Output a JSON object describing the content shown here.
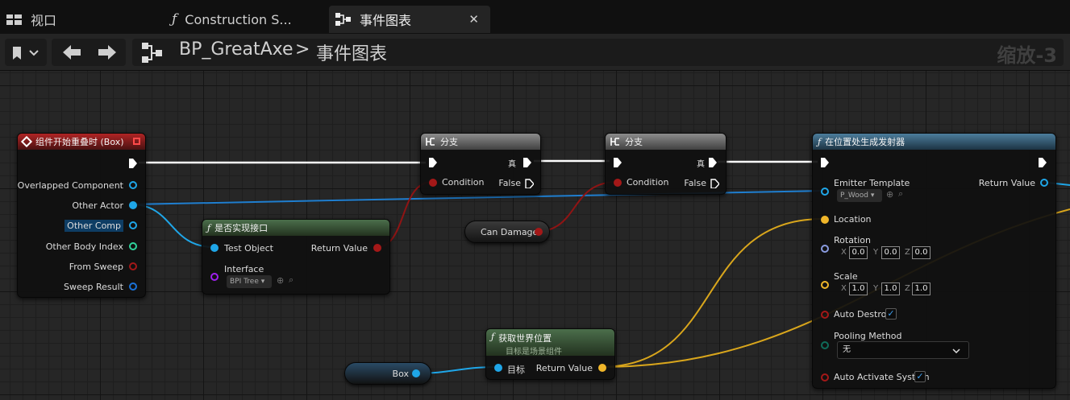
{
  "tabs": [
    {
      "label": "视口",
      "icon": "viewport-grid-icon"
    },
    {
      "label": "Construction S...",
      "icon": "function-icon"
    },
    {
      "label": "事件图表",
      "icon": "graph-icon",
      "active": true
    }
  ],
  "toolbar": {
    "breadcrumb_root": "BP_GreatAxe",
    "breadcrumb_separator": ">",
    "breadcrumb_current": "事件图表",
    "zoom": "缩放-3"
  },
  "nodes": {
    "overlap_event": {
      "title": "组件开始重叠时 (Box)",
      "pins": [
        "Overlapped Component",
        "Other Actor",
        "Other Comp",
        "Other Body Index",
        "From Sweep",
        "Sweep Result"
      ]
    },
    "implements_interface": {
      "title": "是否实现接口",
      "test_object": "Test Object",
      "interface": "Interface",
      "interface_value": "BPI Tree",
      "return_value": "Return Value"
    },
    "branch1": {
      "title": "分支",
      "condition": "Condition",
      "true_label": "真",
      "false_label": "False"
    },
    "branch2": {
      "title": "分支",
      "condition": "Condition",
      "true_label": "真",
      "false_label": "False"
    },
    "can_damage": {
      "label": "Can Damage"
    },
    "box_var": {
      "label": "Box"
    },
    "get_world_location": {
      "title": "获取世界位置",
      "subtitle": "目标是场景组件",
      "target": "目标",
      "return_value": "Return Value"
    },
    "spawn_emitter": {
      "title": "在位置处生成发射器",
      "emitter_template": "Emitter Template",
      "emitter_value": "P_Wood",
      "return_value": "Return Value",
      "location": "Location",
      "rotation": "Rotation",
      "rotation_values": [
        "0.0",
        "0.0",
        "0.0"
      ],
      "scale": "Scale",
      "scale_values": [
        "1.0",
        "1.0",
        "1.0"
      ],
      "axes": [
        "X",
        "Y",
        "Z"
      ],
      "auto_destroy": "Auto Destroy",
      "auto_destroy_checked": true,
      "pooling_method": "Pooling Method",
      "pooling_value": "无",
      "auto_activate": "Auto Activate System",
      "auto_activate_checked": true
    }
  },
  "colors": {
    "exec": "#ffffff",
    "object": "#1fa6e8",
    "boolean": "#a41818",
    "vector": "#f0b62a",
    "interface": "#a020f0",
    "int": "#2fd39c",
    "struct": "#0d62c9"
  }
}
